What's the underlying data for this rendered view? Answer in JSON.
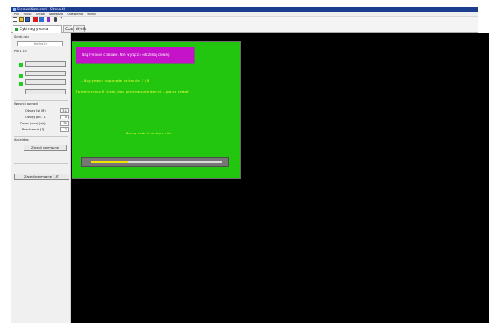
{
  "window": {
    "title": "SterowniKamerami - Strona 40"
  },
  "menu": [
    "Plik",
    "Widok",
    "Ustaw",
    "Narzędzia",
    "Ustawienia",
    "Pomoc"
  ],
  "toolbar": [
    "new-icon",
    "open-icon",
    "save-icon",
    "record-icon",
    "image-icon",
    "bookmark-icon",
    "settings-icon",
    "info-icon"
  ],
  "tabs": [
    {
      "label": "Cykl nagrywania",
      "status_color": "#17a52a"
    },
    {
      "label": "Czas"
    },
    {
      "label": "Wynik"
    }
  ],
  "left": {
    "section_title": "Serial-ssta",
    "serial_field": "Polska 2e",
    "file_label": "Plik 1 AT:",
    "file_buttons": [
      "",
      "",
      "",
      ""
    ],
    "params_title": "Warunki operacji",
    "params": [
      {
        "label": "Odstęp [s] (M)",
        "value": "3,1"
      },
      {
        "label": "Odstęp pkt. [1]",
        "value": "0"
      },
      {
        "label": "Pauza (czas) [s/s]",
        "value": "31"
      },
      {
        "label": "Powtórzenia [1]",
        "value": "2"
      }
    ],
    "actions_title": "Akcja/step",
    "action_button": "Zacznij nagrywanie",
    "bottom_button": "Zacznij nagrywanie 1 AT"
  },
  "main": {
    "banner": "Nagrywanie czasowe. Nie wyłącz i odczekaj chwilę.",
    "status_line1": "...  Nagrywanie rozpoczęte na kanale:   1 / 8",
    "status_line2": "Zarejestrowano 8 klatek, trwa przetwarzanie danych – prosze czekać",
    "status_line3": "Proszę czekać na zapis pliku.",
    "progress": 0.28
  },
  "colors": {
    "panel_green": "#22c60e",
    "banner_magenta": "#c413c8",
    "text_yellow": "#f3ff42",
    "progress_fill": "#f3e400",
    "background": "#000000"
  }
}
